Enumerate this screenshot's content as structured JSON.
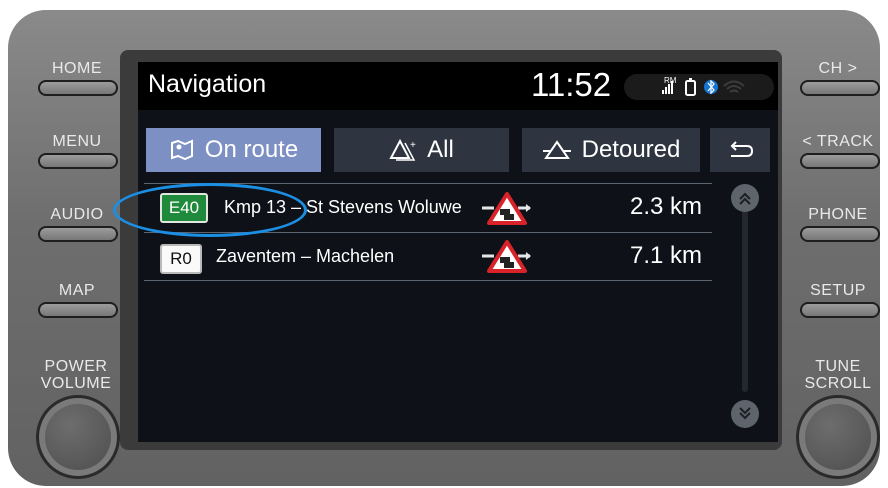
{
  "hardware": {
    "left_buttons": [
      "HOME",
      "MENU",
      "AUDIO",
      "MAP"
    ],
    "left_knob_label": [
      "POWER",
      "VOLUME"
    ],
    "right_buttons": [
      "CH >",
      "< TRACK",
      "PHONE",
      "SETUP"
    ],
    "right_knob_label": [
      "TUNE",
      "SCROLL"
    ]
  },
  "status": {
    "title": "Navigation",
    "time": "11:52",
    "signal_label": "RM"
  },
  "tabs": [
    {
      "label": "On route",
      "icon": "map-route-icon",
      "active": true
    },
    {
      "label": "All",
      "icon": "warning-all-icon",
      "active": false
    },
    {
      "label": "Detoured",
      "icon": "detour-icon",
      "active": false
    }
  ],
  "back_label": "back-arrow-icon",
  "incidents": [
    {
      "road": "E40",
      "road_type": "motorway",
      "description": "Kmp 13 – St Stevens Woluwe",
      "icon": "traffic-jam-icon",
      "distance": "2.3 km"
    },
    {
      "road": "R0",
      "road_type": "ring",
      "description": "Zaventem – Machelen",
      "icon": "traffic-jam-icon",
      "distance": "7.1 km"
    }
  ],
  "colors": {
    "active_tab": "#7d90c4",
    "motorway_badge": "#1f8a3b",
    "highlight": "#1b8fe3"
  }
}
